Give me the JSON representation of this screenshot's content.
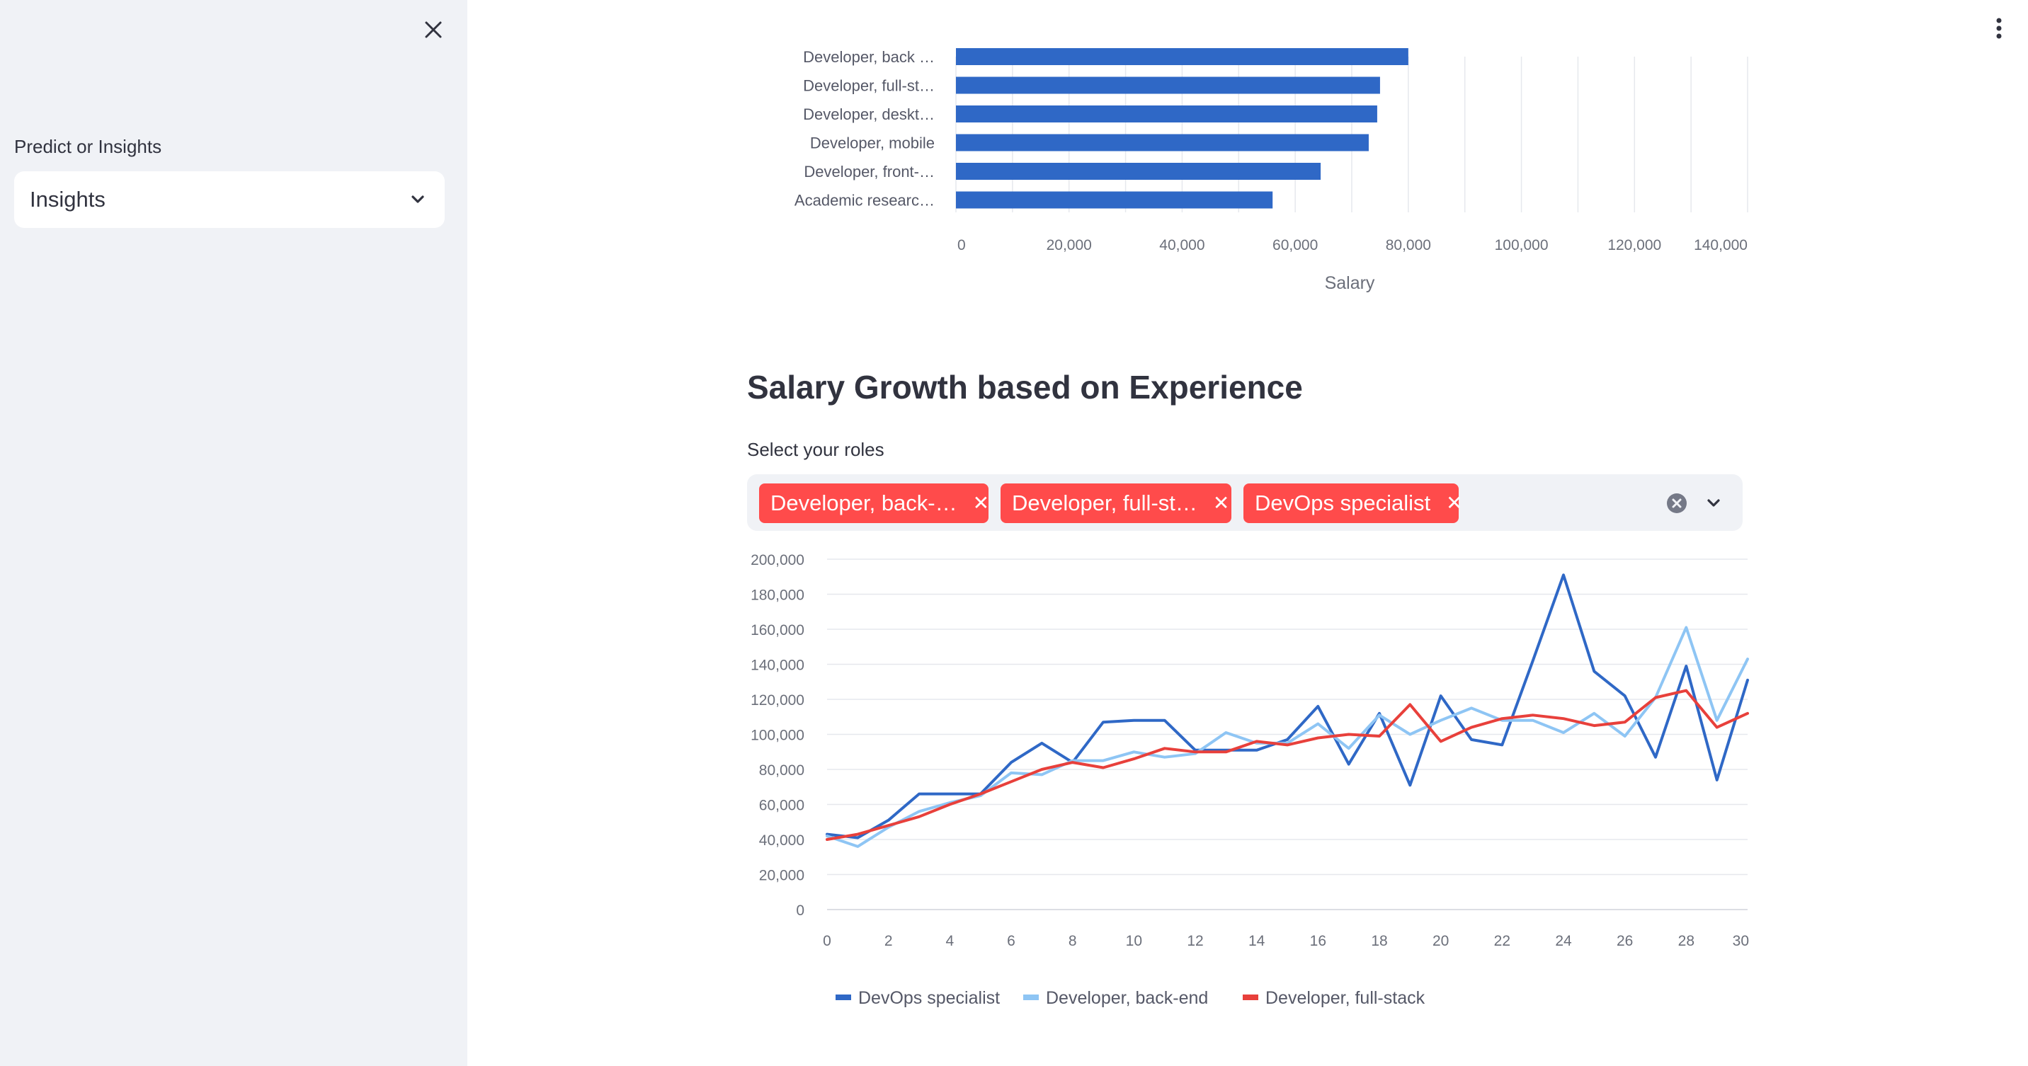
{
  "sidebar": {
    "close_icon": "close-icon",
    "select_label": "Predict or Insights",
    "select_value": "Insights"
  },
  "menu_icon": "kebab-menu-icon",
  "bar_chart": {
    "xlabel": "Salary",
    "chart_data": {
      "type": "bar",
      "orientation": "horizontal",
      "categories": [
        "Developer, back …",
        "Developer, full-st…",
        "Developer, deskt…",
        "Developer, mobile",
        "Developer, front-…",
        "Academic researc…"
      ],
      "values": [
        80000,
        75000,
        74500,
        73000,
        64500,
        56000
      ],
      "xlabel": "Salary",
      "xlim": [
        0,
        140000
      ],
      "x_ticks": [
        "0",
        "20,000",
        "40,000",
        "60,000",
        "80,000",
        "100,000",
        "120,000",
        "140,000"
      ],
      "color": "#2f68c6",
      "grid": true
    }
  },
  "growth": {
    "title": "Salary Growth based on Experience",
    "select_label": "Select your roles",
    "tags": [
      "Developer, back-…",
      "Developer, full-st…",
      "DevOps specialist"
    ],
    "legend": [
      "DevOps specialist",
      "Developer, back-end",
      "Developer, full-stack"
    ]
  },
  "chart_data": {
    "type": "line",
    "x": [
      0,
      1,
      2,
      3,
      4,
      5,
      6,
      7,
      8,
      9,
      10,
      11,
      12,
      13,
      14,
      15,
      16,
      17,
      18,
      19,
      20,
      21,
      22,
      23,
      24,
      25,
      26,
      27,
      28,
      29,
      30
    ],
    "ylim": [
      0,
      200000
    ],
    "xlim": [
      0,
      30
    ],
    "y_ticks": [
      "200,000",
      "180,000",
      "160,000",
      "140,000",
      "120,000",
      "100,000",
      "80,000",
      "60,000",
      "40,000",
      "20,000",
      "0"
    ],
    "x_ticks": [
      "0",
      "2",
      "4",
      "6",
      "8",
      "10",
      "12",
      "14",
      "16",
      "18",
      "20",
      "22",
      "24",
      "26",
      "28",
      "30"
    ],
    "grid": true,
    "legend_position": "bottom",
    "series": [
      {
        "name": "DevOps specialist",
        "color": "#2f68c6",
        "values": [
          43000,
          41000,
          51000,
          66000,
          66000,
          66000,
          84000,
          95000,
          84000,
          107000,
          108000,
          108000,
          91000,
          91000,
          91000,
          97000,
          116000,
          83000,
          112000,
          71000,
          122000,
          97000,
          94000,
          142000,
          191000,
          136000,
          122000,
          87000,
          139000,
          74000,
          131000
        ]
      },
      {
        "name": "Developer, back-end",
        "color": "#8ec5f4",
        "values": [
          42000,
          36000,
          47000,
          56000,
          61000,
          65000,
          78000,
          77000,
          85000,
          85000,
          90000,
          87000,
          89000,
          101000,
          95000,
          95000,
          106000,
          92000,
          111000,
          100000,
          108000,
          115000,
          108000,
          108000,
          101000,
          112000,
          99000,
          121000,
          161000,
          108000,
          143000
        ]
      },
      {
        "name": "Developer, full-stack",
        "color": "#e8403b",
        "values": [
          40000,
          43000,
          48000,
          53000,
          60000,
          66000,
          73000,
          80000,
          84000,
          81000,
          86000,
          92000,
          90000,
          90000,
          96000,
          94000,
          98000,
          100000,
          99000,
          117000,
          96000,
          104000,
          109000,
          111000,
          109000,
          105000,
          107000,
          121000,
          125000,
          104000,
          112000
        ]
      }
    ]
  }
}
